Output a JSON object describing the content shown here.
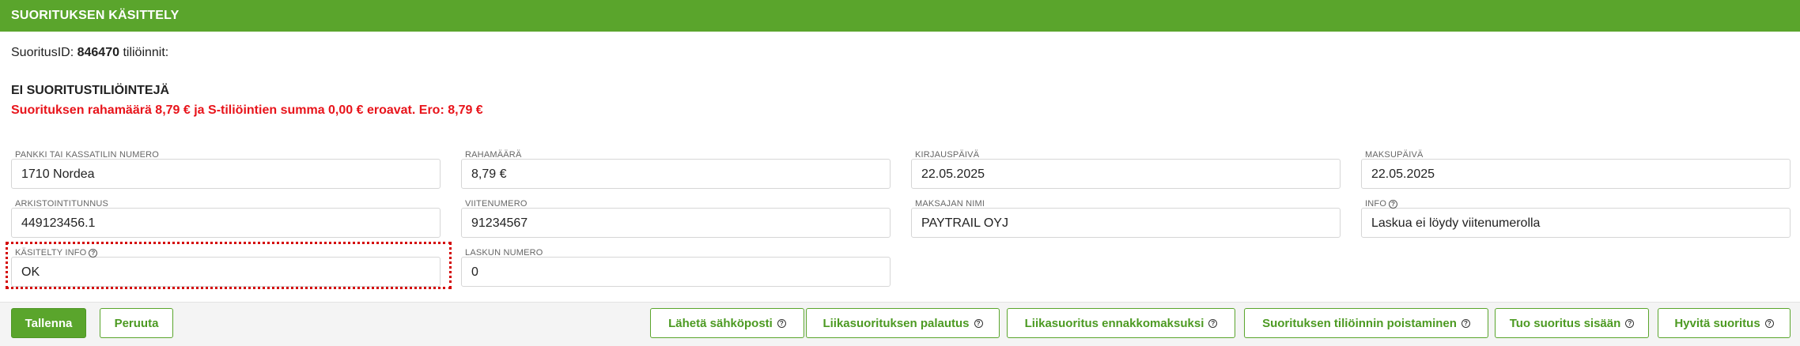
{
  "header": {
    "title": "SUORITUKSEN KÄSITTELY"
  },
  "summary": {
    "id_label": "SuoritusID:",
    "id_value": "846470",
    "suffix": "tiliöinnit:",
    "no_entries": "EI SUORITUSTILIÖINTEJÄ",
    "error": "Suorituksen rahamäärä 8,79 € ja S-tiliöintien summa 0,00 € eroavat. Ero: 8,79 €"
  },
  "fields": {
    "pankki": {
      "label": "PANKKI TAI KASSATILIN NUMERO",
      "value": "1710 Nordea"
    },
    "rahamaara": {
      "label": "RAHAMÄÄRÄ",
      "value": "8,79 €"
    },
    "kirjauspaiva": {
      "label": "KIRJAUSPÄIVÄ",
      "value": "22.05.2025"
    },
    "maksupaiva": {
      "label": "MAKSUPÄIVÄ",
      "value": "22.05.2025"
    },
    "arkistointitunnus": {
      "label": "ARKISTOINTITUNNUS",
      "value": "449123456.1"
    },
    "viitenumero": {
      "label": "VIITENUMERO",
      "value": "91234567"
    },
    "maksajan_nimi": {
      "label": "MAKSAJAN NIMI",
      "value": "PAYTRAIL OYJ"
    },
    "info": {
      "label": "INFO",
      "value": "Laskua ei löydy viitenumerolla"
    },
    "kasitelty_info": {
      "label": "KÄSITELTY INFO",
      "value": "OK"
    },
    "laskun_numero": {
      "label": "LASKUN NUMERO",
      "value": "0"
    }
  },
  "help_glyph": "?",
  "buttons": {
    "tallenna": "Tallenna",
    "peruuta": "Peruuta",
    "laheta": "Lähetä sähköposti",
    "palautus": "Liikasuorituksen palautus",
    "ennakko": "Liikasuoritus ennakkomaksuksi",
    "poistaminen": "Suorituksen tiliöinnin poistaminen",
    "tuo": "Tuo suoritus sisään",
    "hyvita": "Hyvitä suoritus"
  },
  "colors": {
    "accent": "#5aa52c",
    "error": "#e8141b",
    "highlight": "#d40000"
  }
}
